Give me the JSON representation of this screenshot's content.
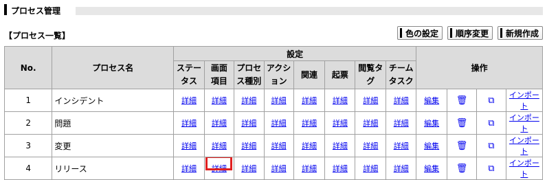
{
  "page": {
    "title": "プロセス管理"
  },
  "list": {
    "title": "【プロセス一覧】"
  },
  "buttons": {
    "color": "色の設定",
    "order": "順序変更",
    "new": "新規作成"
  },
  "table": {
    "col_no": "No.",
    "col_name": "プロセス名",
    "col_settings": "設定",
    "col_ops": "操作",
    "settings_cols": [
      [
        "ステー",
        "タス"
      ],
      [
        "画面",
        "項目"
      ],
      [
        "プロセ",
        "ス種別"
      ],
      [
        "アクシ",
        "ョン"
      ],
      [
        "関連",
        ""
      ],
      [
        "起票",
        ""
      ],
      [
        "閲覧タ",
        "グ"
      ],
      [
        "チーム",
        "タスク"
      ]
    ],
    "link_detail": "詳細",
    "op_edit": "編集",
    "op_import": "インポート",
    "rows": [
      {
        "no": "1",
        "name": "インシデント"
      },
      {
        "no": "2",
        "name": "問題"
      },
      {
        "no": "3",
        "name": "変更"
      },
      {
        "no": "4",
        "name": "リリース"
      }
    ]
  },
  "icons": {
    "trash": "trash-icon",
    "copy": "copy-icon"
  },
  "colors": {
    "header_bg": "#dcdcdc",
    "link": "#0000ee",
    "highlight": "#e02020"
  }
}
